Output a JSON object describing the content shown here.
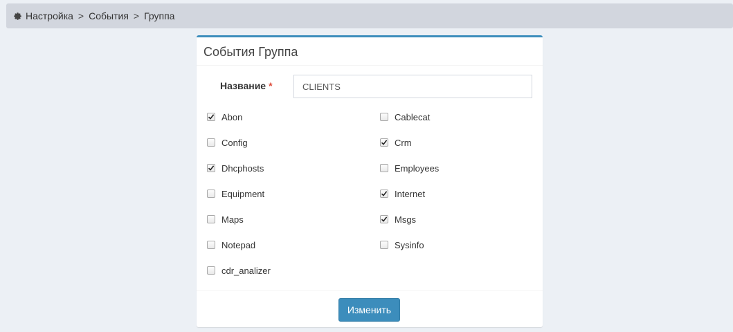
{
  "breadcrumb": {
    "items": [
      "Настройка",
      "События",
      "Группа"
    ],
    "separator": ">"
  },
  "panel": {
    "title": "События Группа",
    "name_label": "Название",
    "required_mark": "*",
    "name_value": "CLIENTS",
    "submit_label": "Изменить"
  },
  "modules": [
    {
      "label": "Abon",
      "checked": true
    },
    {
      "label": "Cablecat",
      "checked": false
    },
    {
      "label": "Config",
      "checked": false
    },
    {
      "label": "Crm",
      "checked": true
    },
    {
      "label": "Dhcphosts",
      "checked": true
    },
    {
      "label": "Employees",
      "checked": false
    },
    {
      "label": "Equipment",
      "checked": false
    },
    {
      "label": "Internet",
      "checked": true
    },
    {
      "label": "Maps",
      "checked": false
    },
    {
      "label": "Msgs",
      "checked": true
    },
    {
      "label": "Notepad",
      "checked": false
    },
    {
      "label": "Sysinfo",
      "checked": false
    },
    {
      "label": "cdr_analizer",
      "checked": false
    }
  ],
  "colors": {
    "accent": "#3c8dbc",
    "background": "#ecf0f5",
    "breadcrumb_bg": "#d2d6de",
    "required": "#dd4b39"
  }
}
